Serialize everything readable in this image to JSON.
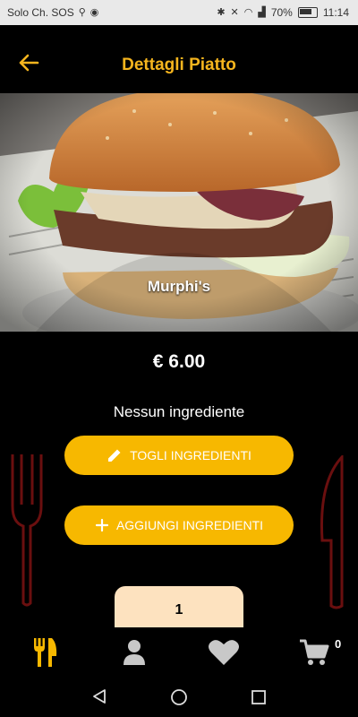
{
  "status_bar": {
    "carrier": "Solo Ch. SOS",
    "battery": "70%",
    "time": "11:14"
  },
  "appbar": {
    "title": "Dettagli Piatto"
  },
  "dish": {
    "name": "Murphi's",
    "price": "€ 6.00",
    "ingredients_text": "Nessun ingrediente"
  },
  "actions": {
    "remove_label": "TOGLI INGREDIENTI",
    "add_label": "AGGIUNGI INGREDIENTI"
  },
  "quantity": "1",
  "bottom_nav": {
    "cart_count": "0"
  },
  "colors": {
    "accent": "#f7b800",
    "title_yellow": "#f6b51e",
    "qty_bg": "#fde2bf",
    "deco_red": "#6a0f0f",
    "icon_gray": "#c8c8c8"
  }
}
